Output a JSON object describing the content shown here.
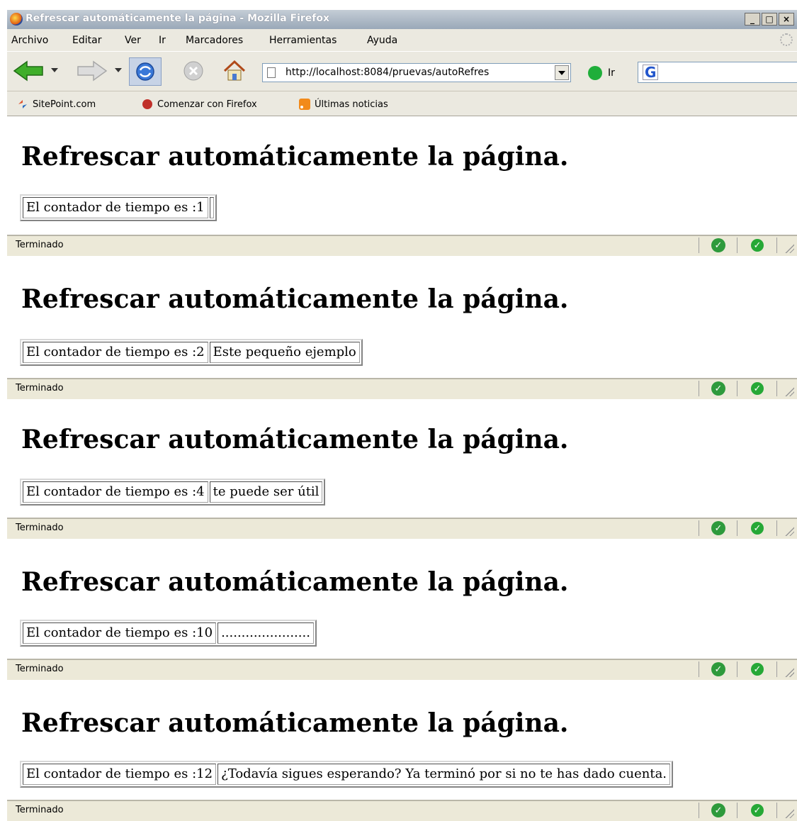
{
  "window": {
    "title": "Refrescar automáticamente la página - Mozilla Firefox",
    "buttons": [
      "_",
      "□",
      "×"
    ]
  },
  "menu": [
    "Archivo",
    "Editar",
    "Ver",
    "Ir",
    "Marcadores",
    "Herramientas",
    "Ayuda"
  ],
  "toolbar": {
    "url": "http://localhost:8084/pruevas/autoRefres",
    "go_label": "Ir",
    "search_value": "",
    "icons": [
      "back-arrow-icon",
      "forward-arrow-icon",
      "reload-icon",
      "stop-icon",
      "home-icon",
      "go-icon",
      "google-search-icon"
    ]
  },
  "bookmarks": [
    {
      "label": "SitePoint.com",
      "icon": "sitepoint-icon"
    },
    {
      "label": "Comenzar con Firefox",
      "icon": "firefox-bookmark-icon"
    },
    {
      "label": "Últimas noticias",
      "icon": "rss-feed-icon"
    }
  ],
  "snapshots": [
    {
      "heading": "Refrescar automáticamente la página.",
      "counter": "El contador de tiempo es :1",
      "message": "",
      "status": "Terminado"
    },
    {
      "heading": "Refrescar automáticamente la página.",
      "counter": "El contador de tiempo es :2",
      "message": "Este pequeño ejemplo",
      "status": "Terminado"
    },
    {
      "heading": "Refrescar automáticamente la página.",
      "counter": "El contador de tiempo es :4",
      "message": "te puede ser útil",
      "status": "Terminado"
    },
    {
      "heading": "Refrescar automáticamente la página.",
      "counter": "El contador de tiempo es :10",
      "message": "......................",
      "status": "Terminado"
    },
    {
      "heading": "Refrescar automáticamente la página.",
      "counter": "El contador de tiempo es :12",
      "message": "¿Todavía sigues esperando? Ya terminó por si no te has dado cuenta.",
      "status": "Terminado"
    }
  ]
}
